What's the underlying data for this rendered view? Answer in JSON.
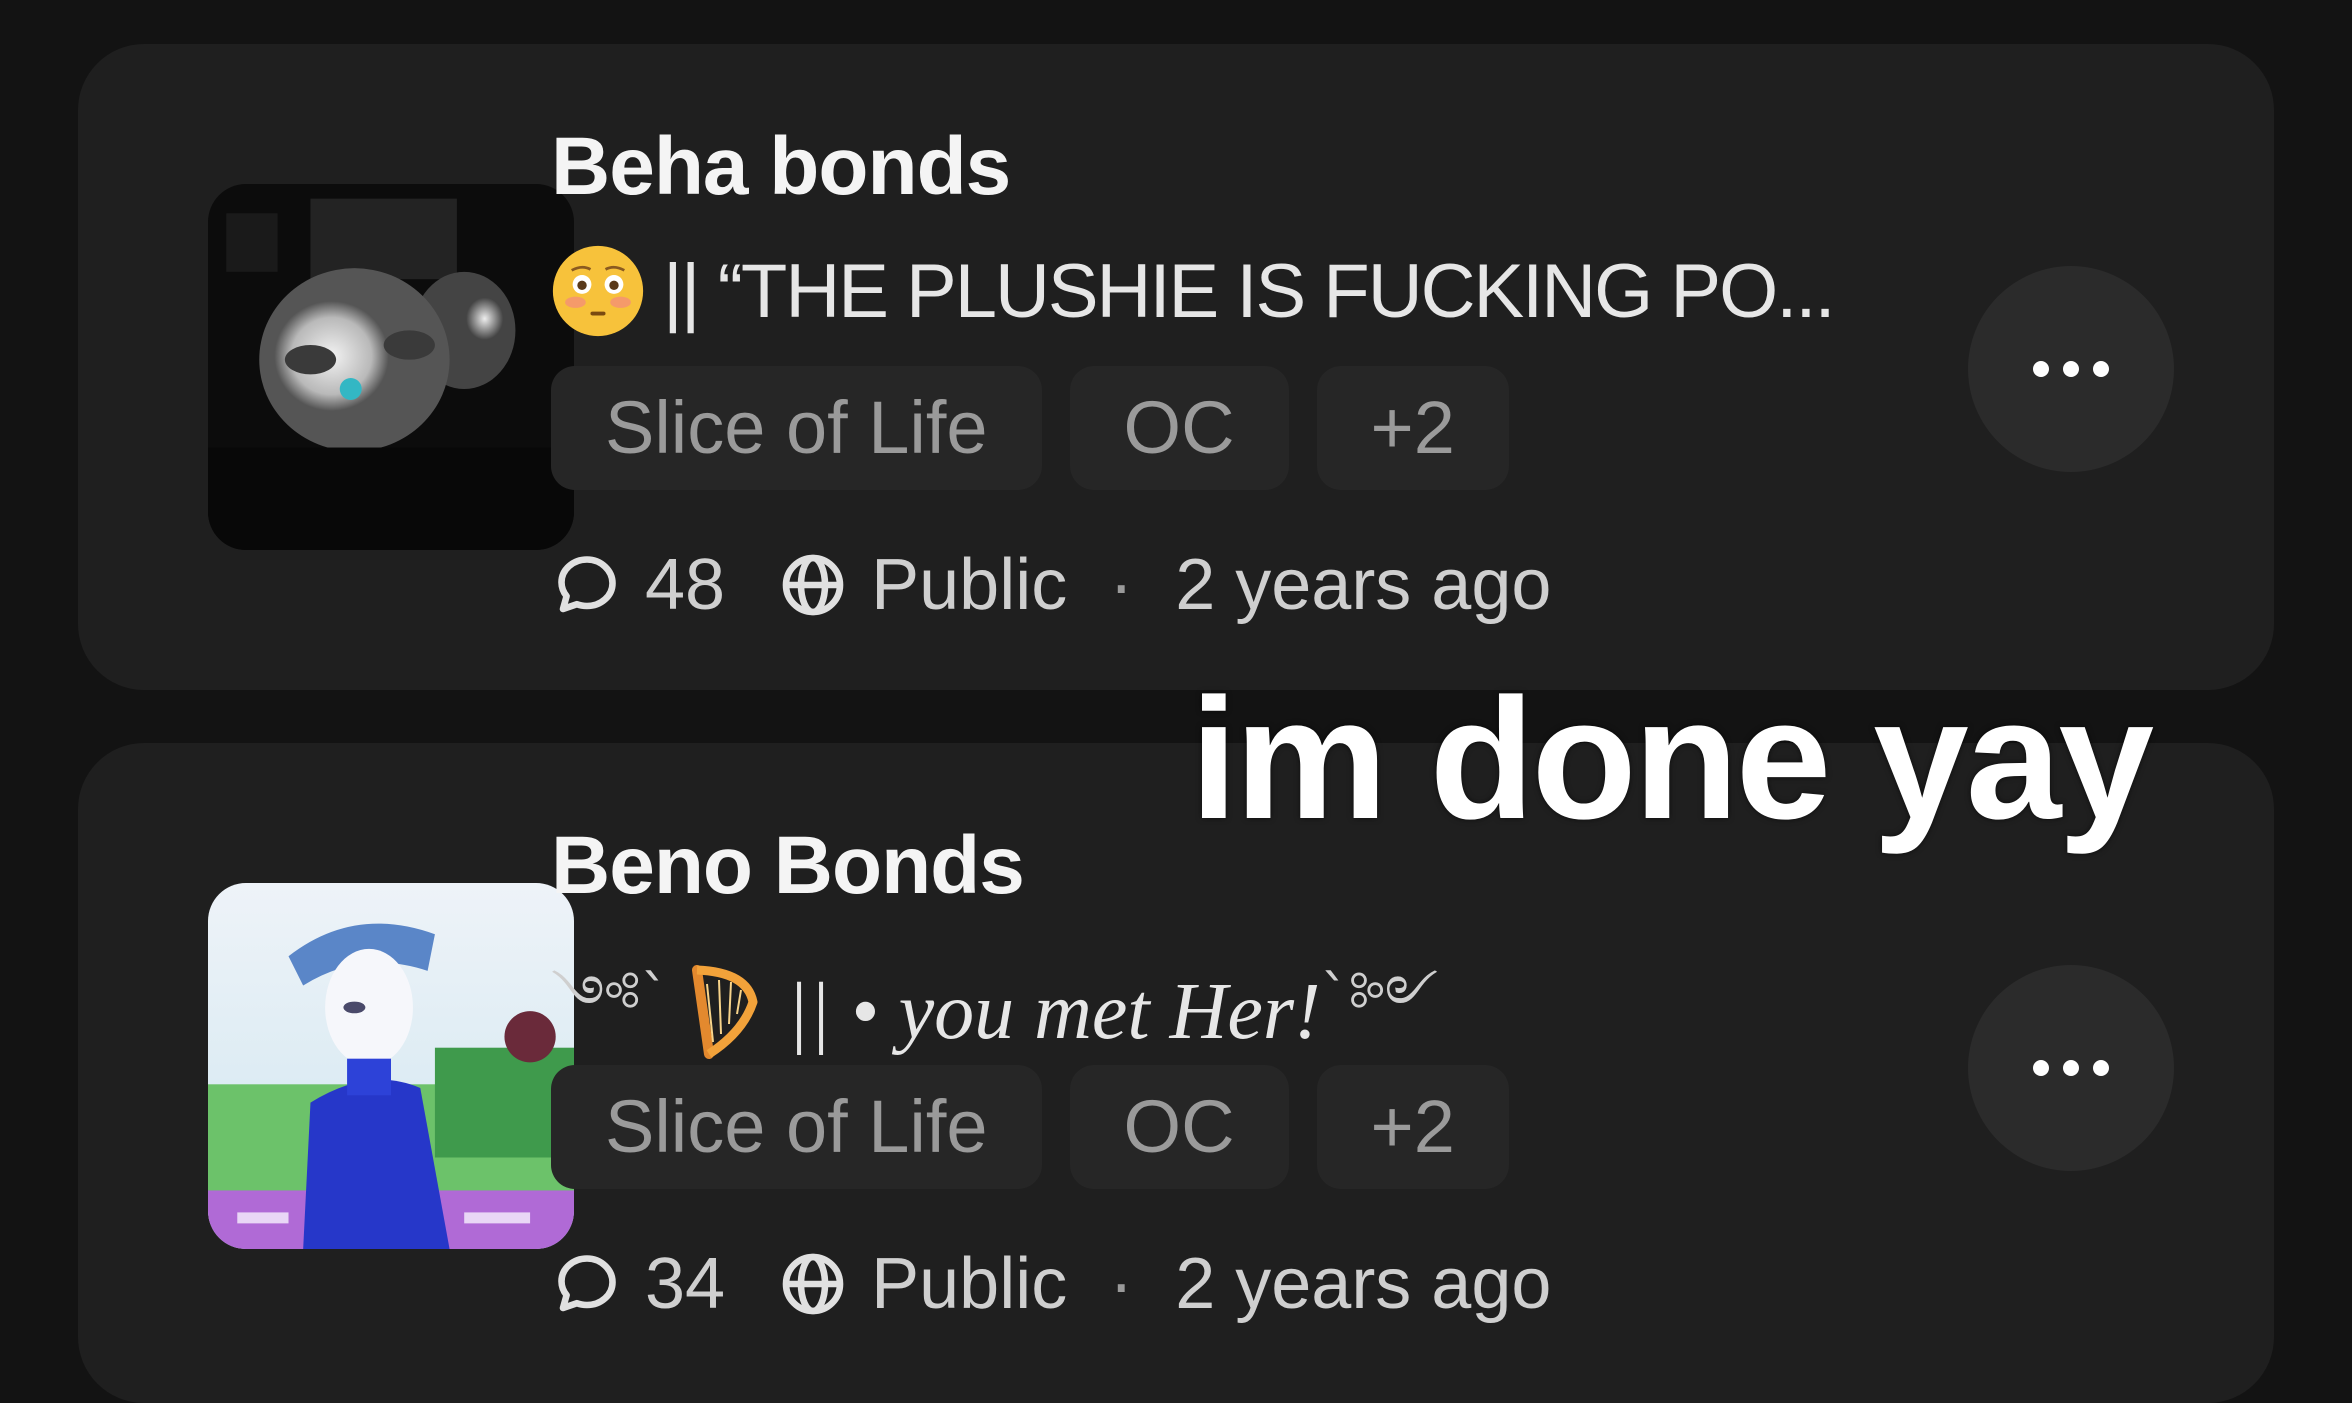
{
  "chats": [
    {
      "title": "Beha bonds",
      "description": "|| “THE PLUSHIE IS FUCKING PO...",
      "description_emoji": "flushed-face-icon",
      "tags": [
        "Slice of Life",
        "OC",
        "+2"
      ],
      "comment_count": "48",
      "visibility": "Public",
      "separator": "·",
      "time_ago": "2 years ago"
    },
    {
      "title": "Beno Bonds",
      "description_prefix": "༺`",
      "description_emoji": "harp-icon",
      "description": "|| • you met Her!",
      "description_suffix": "`༻",
      "tags": [
        "Slice of Life",
        "OC",
        "+2"
      ],
      "comment_count": "34",
      "visibility": "Public",
      "separator": "·",
      "time_ago": "2 years ago"
    }
  ],
  "overlay_caption": "im done yay",
  "colors": {
    "background": "#131313",
    "card": "#1f1f1f",
    "tag_bg": "#262626",
    "tag_text": "#9a9a9a",
    "button_bg": "#2b2b2b"
  }
}
